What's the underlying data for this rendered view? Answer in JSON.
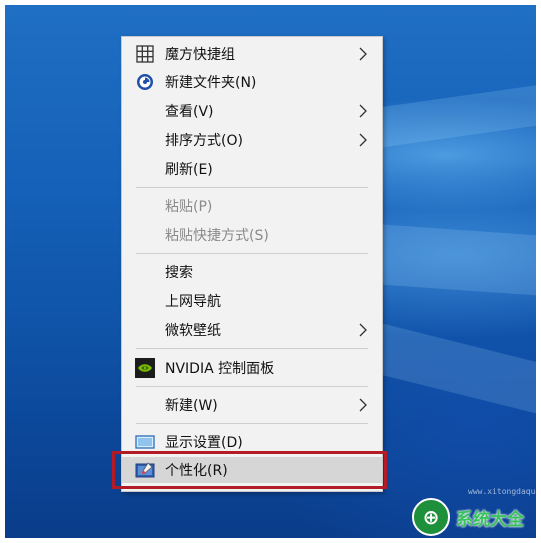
{
  "menu": {
    "items": [
      {
        "label": "魔方快捷组",
        "icon": "grid-icon",
        "submenu": true,
        "disabled": false
      },
      {
        "label": "新建文件夹(N)",
        "icon": "folder-app-icon",
        "submenu": false,
        "disabled": false
      },
      {
        "label": "查看(V)",
        "icon": null,
        "submenu": true,
        "disabled": false
      },
      {
        "label": "排序方式(O)",
        "icon": null,
        "submenu": true,
        "disabled": false
      },
      {
        "label": "刷新(E)",
        "icon": null,
        "submenu": false,
        "disabled": false
      },
      {
        "label": "粘贴(P)",
        "icon": null,
        "submenu": false,
        "disabled": true
      },
      {
        "label": "粘贴快捷方式(S)",
        "icon": null,
        "submenu": false,
        "disabled": true
      },
      {
        "label": "搜索",
        "icon": null,
        "submenu": false,
        "disabled": false
      },
      {
        "label": "上网导航",
        "icon": null,
        "submenu": false,
        "disabled": false
      },
      {
        "label": "微软壁纸",
        "icon": null,
        "submenu": true,
        "disabled": false
      },
      {
        "label": "NVIDIA 控制面板",
        "icon": "nvidia-icon",
        "submenu": false,
        "disabled": false
      },
      {
        "label": "新建(W)",
        "icon": null,
        "submenu": true,
        "disabled": false
      },
      {
        "label": "显示设置(D)",
        "icon": "display-icon",
        "submenu": false,
        "disabled": false
      },
      {
        "label": "个性化(R)",
        "icon": "personalize-icon",
        "submenu": false,
        "disabled": false,
        "highlighted": true
      }
    ]
  },
  "colors": {
    "highlight_border": "#b31c26",
    "menu_background": "#f2f2f2",
    "desktop_blue": "#1560b8"
  },
  "watermark": {
    "text": "系统大全",
    "url": "www.xitongdaquan.com"
  }
}
